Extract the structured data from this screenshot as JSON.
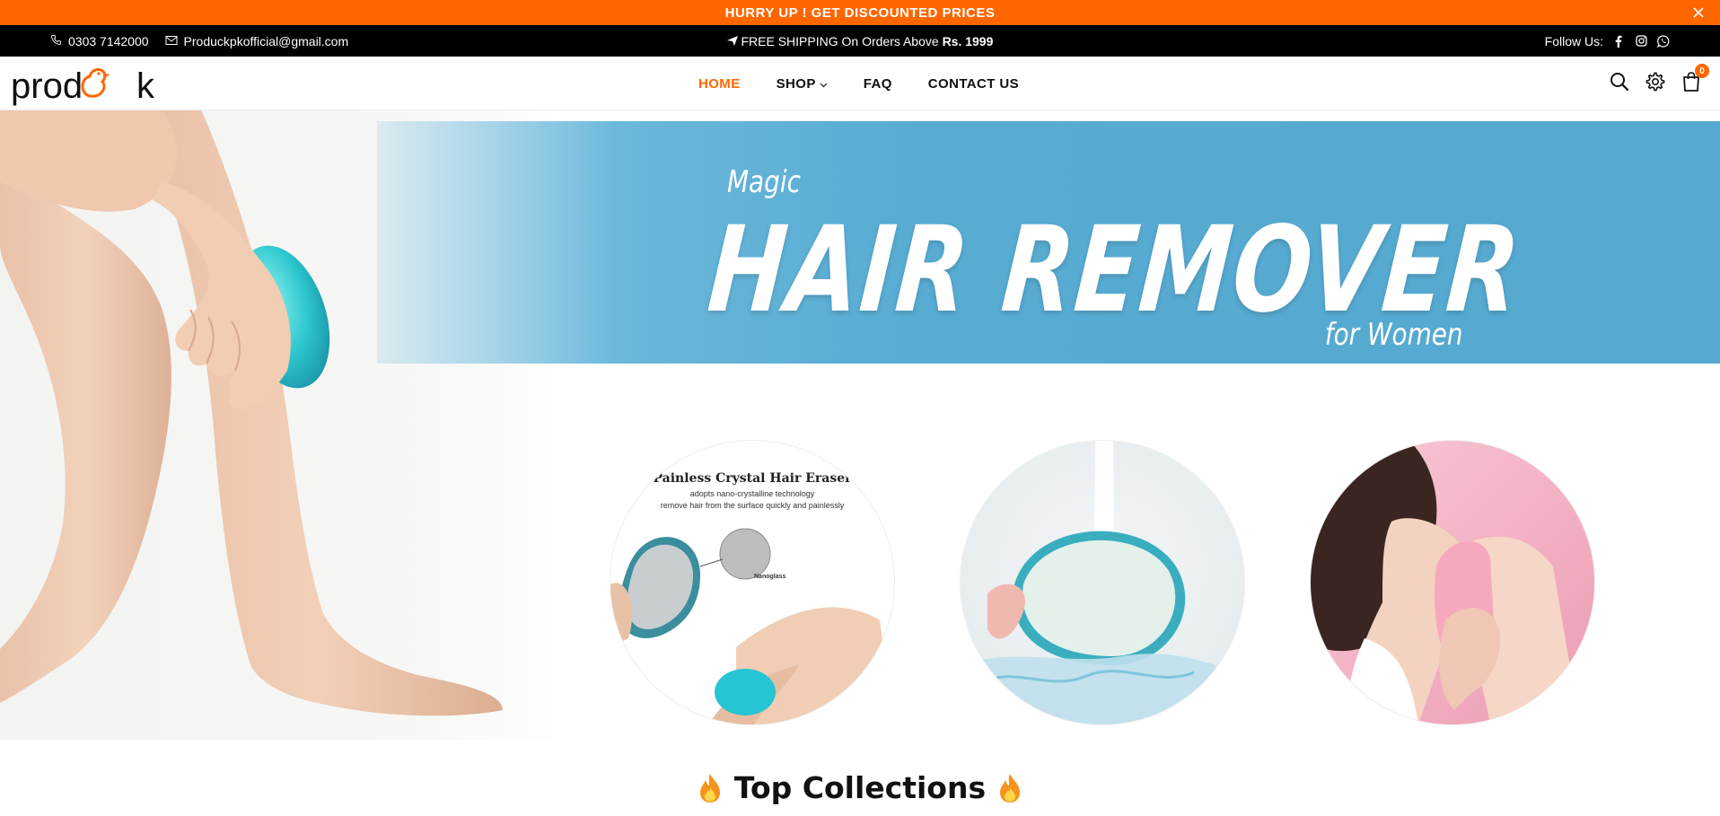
{
  "announcement": {
    "text": "HURRY UP ! GET DISCOUNTED PRICES"
  },
  "topbar": {
    "phone": "0303 7142000",
    "email": "Produckpkofficial@gmail.com",
    "shipping_text": "FREE SHIPPING On Orders Above ",
    "shipping_amount": "Rs. 1999",
    "follow_label": "Follow Us:",
    "social_icons": [
      "facebook-icon",
      "instagram-icon",
      "whatsapp-icon"
    ]
  },
  "header": {
    "logo_text_left": "prod",
    "logo_text_right": "k",
    "nav": [
      {
        "label": "HOME",
        "active": true
      },
      {
        "label": "SHOP",
        "has_dropdown": true
      },
      {
        "label": "FAQ"
      },
      {
        "label": "CONTACT US"
      }
    ],
    "cart_count": "0",
    "icons": [
      "search-icon",
      "settings-icon",
      "cart-icon"
    ]
  },
  "hero": {
    "tagline_top": "Magic",
    "headline": "HAIR REMOVER",
    "tagline_bottom": "for Women",
    "circle1": {
      "title": "Painless Crystal Hair Eraser",
      "line1": "adopts nano-crystalline technology",
      "line2": "remove hair from the surface quickly and painlessly",
      "tag": "Nanoglass"
    }
  },
  "collections": {
    "title": "Top Collections"
  },
  "colors": {
    "accent": "#ff6600",
    "topbar": "#000000",
    "banner": "#58acd2"
  }
}
